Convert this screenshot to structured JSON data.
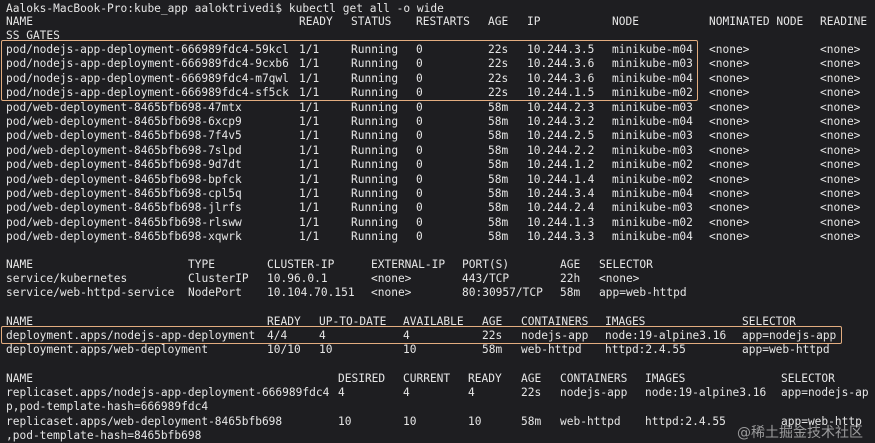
{
  "prompt": "Aaloks-MacBook-Pro:kube_app aaloktrivedi$ kubectl get all -o wide",
  "pods": {
    "header": [
      "NAME",
      "READY",
      "STATUS",
      "RESTARTS",
      "AGE",
      "IP",
      "NODE",
      "NOMINATED NODE",
      "READINE"
    ],
    "header_wrap": "SS GATES",
    "rows": [
      [
        "pod/nodejs-app-deployment-666989fdc4-59kcl",
        "1/1",
        "Running",
        "0",
        "22s",
        "10.244.3.5",
        "minikube-m04",
        "<none>",
        "<none>"
      ],
      [
        "pod/nodejs-app-deployment-666989fdc4-9cxb6",
        "1/1",
        "Running",
        "0",
        "22s",
        "10.244.3.6",
        "minikube-m03",
        "<none>",
        "<none>"
      ],
      [
        "pod/nodejs-app-deployment-666989fdc4-m7qwl",
        "1/1",
        "Running",
        "0",
        "22s",
        "10.244.3.6",
        "minikube-m04",
        "<none>",
        "<none>"
      ],
      [
        "pod/nodejs-app-deployment-666989fdc4-sf5ck",
        "1/1",
        "Running",
        "0",
        "22s",
        "10.244.1.5",
        "minikube-m02",
        "<none>",
        "<none>"
      ],
      [
        "pod/web-deployment-8465bfb698-47mtx",
        "1/1",
        "Running",
        "0",
        "58m",
        "10.244.2.3",
        "minikube-m03",
        "<none>",
        "<none>"
      ],
      [
        "pod/web-deployment-8465bfb698-6xcp9",
        "1/1",
        "Running",
        "0",
        "58m",
        "10.244.3.2",
        "minikube-m04",
        "<none>",
        "<none>"
      ],
      [
        "pod/web-deployment-8465bfb698-7f4v5",
        "1/1",
        "Running",
        "0",
        "58m",
        "10.244.2.5",
        "minikube-m03",
        "<none>",
        "<none>"
      ],
      [
        "pod/web-deployment-8465bfb698-7slpd",
        "1/1",
        "Running",
        "0",
        "58m",
        "10.244.2.2",
        "minikube-m03",
        "<none>",
        "<none>"
      ],
      [
        "pod/web-deployment-8465bfb698-9d7dt",
        "1/1",
        "Running",
        "0",
        "58m",
        "10.244.1.2",
        "minikube-m02",
        "<none>",
        "<none>"
      ],
      [
        "pod/web-deployment-8465bfb698-bpfck",
        "1/1",
        "Running",
        "0",
        "58m",
        "10.244.1.4",
        "minikube-m02",
        "<none>",
        "<none>"
      ],
      [
        "pod/web-deployment-8465bfb698-cpl5q",
        "1/1",
        "Running",
        "0",
        "58m",
        "10.244.3.4",
        "minikube-m04",
        "<none>",
        "<none>"
      ],
      [
        "pod/web-deployment-8465bfb698-jlrfs",
        "1/1",
        "Running",
        "0",
        "58m",
        "10.244.2.4",
        "minikube-m03",
        "<none>",
        "<none>"
      ],
      [
        "pod/web-deployment-8465bfb698-rlsww",
        "1/1",
        "Running",
        "0",
        "58m",
        "10.244.1.3",
        "minikube-m02",
        "<none>",
        "<none>"
      ],
      [
        "pod/web-deployment-8465bfb698-xqwrk",
        "1/1",
        "Running",
        "0",
        "58m",
        "10.244.3.3",
        "minikube-m04",
        "<none>",
        "<none>"
      ]
    ]
  },
  "services": {
    "header": [
      "NAME",
      "TYPE",
      "CLUSTER-IP",
      "EXTERNAL-IP",
      "PORT(S)",
      "AGE",
      "SELECTOR"
    ],
    "rows": [
      [
        "service/kubernetes",
        "ClusterIP",
        "10.96.0.1",
        "<none>",
        "443/TCP",
        "22h",
        "<none>"
      ],
      [
        "service/web-httpd-service",
        "NodePort",
        "10.104.70.151",
        "<none>",
        "80:30957/TCP",
        "58m",
        "app=web-httpd"
      ]
    ]
  },
  "deployments": {
    "header": [
      "NAME",
      "READY",
      "UP-TO-DATE",
      "AVAILABLE",
      "AGE",
      "CONTAINERS",
      "IMAGES",
      "SELECTOR"
    ],
    "rows": [
      [
        "deployment.apps/nodejs-app-deployment",
        "4/4",
        "4",
        "4",
        "22s",
        "nodejs-app",
        "node:19-alpine3.16",
        "app=nodejs-app"
      ],
      [
        "deployment.apps/web-deployment",
        "10/10",
        "10",
        "10",
        "58m",
        "web-httpd",
        "httpd:2.4.55",
        "app=web-httpd"
      ]
    ]
  },
  "replicasets": {
    "header": [
      "NAME",
      "DESIRED",
      "CURRENT",
      "READY",
      "AGE",
      "CONTAINERS",
      "IMAGES",
      "SELECTOR"
    ],
    "rows": [
      [
        "replicaset.apps/nodejs-app-deployment-666989fdc4",
        "4",
        "4",
        "4",
        "22s",
        "nodejs-app",
        "node:19-alpine3.16",
        "app=nodejs-ap"
      ],
      [
        "replicaset.apps/web-deployment-8465bfb698",
        "10",
        "10",
        "10",
        "58m",
        "web-httpd",
        "httpd:2.4.55",
        "app=web-http"
      ]
    ],
    "wraps": [
      "p,pod-template-hash=666989fdc4",
      ",pod-template-hash=8465bfb698"
    ]
  },
  "watermark": "@稀土掘金技术社区",
  "colors": {
    "background": "#1e1e21",
    "text": "#e6e6e6",
    "highlight_border": "#e3ad80"
  }
}
